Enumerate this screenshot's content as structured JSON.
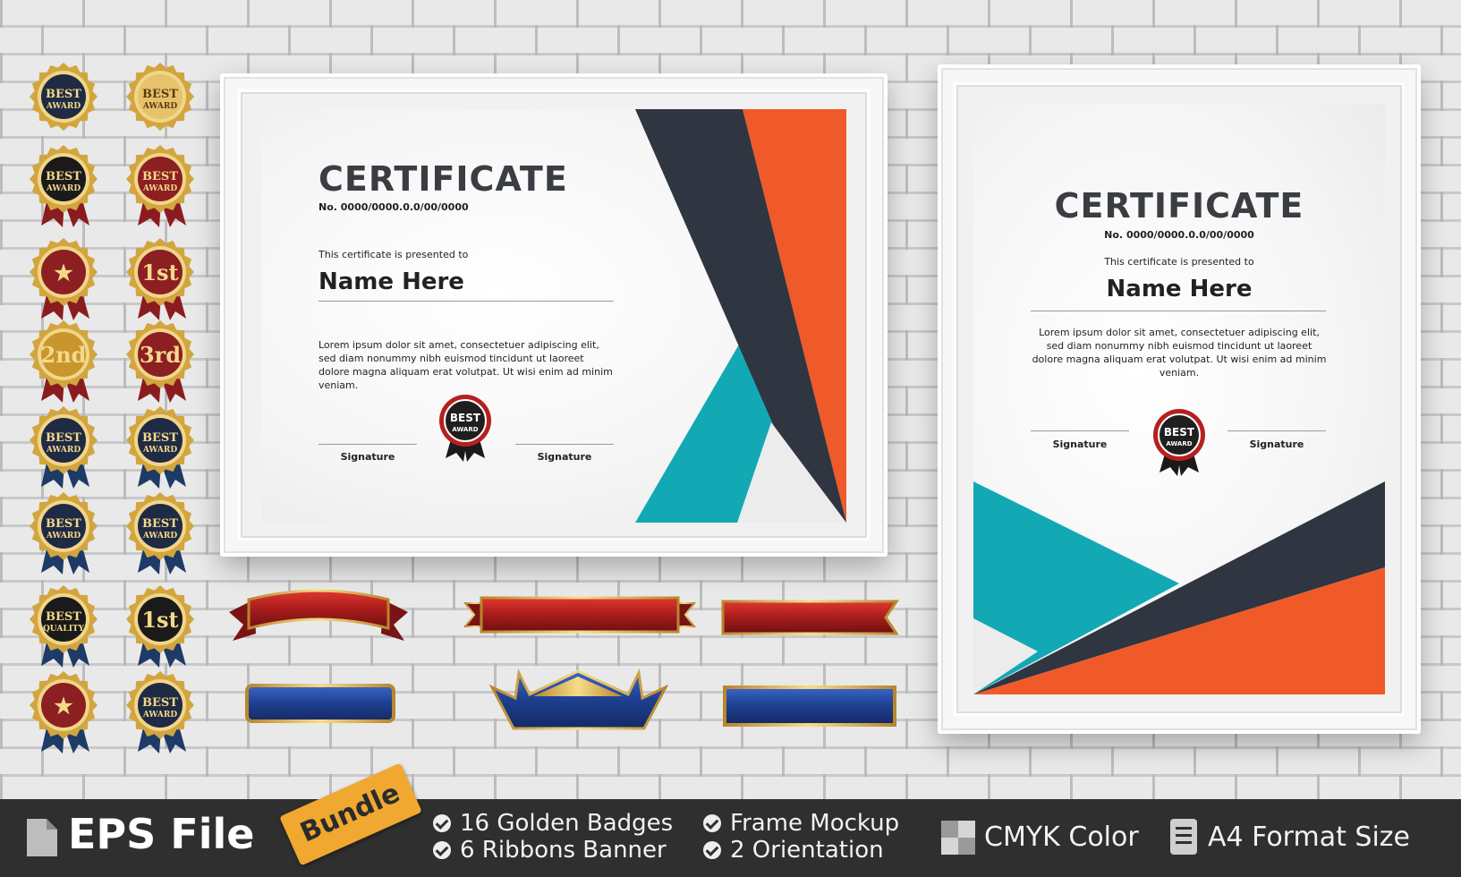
{
  "certificate_landscape": {
    "title": "CERTIFICATE",
    "number": "No. 0000/0000.0.0/00/0000",
    "presented": "This certificate is presented to",
    "name": "Name Here",
    "lorem": "Lorem ipsum dolor sit amet, consectetuer adipiscing elit, sed diam nonummy nibh euismod tincidunt ut laoreet dolore magna aliquam erat volutpat. Ut wisi enim ad minim veniam.",
    "signature_left": "Signature",
    "signature_right": "Signature",
    "seal_line1": "BEST",
    "seal_line2": "AWARD"
  },
  "certificate_portrait": {
    "title": "CERTIFICATE",
    "number": "No. 0000/0000.0.0/00/0000",
    "presented": "This certificate is presented to",
    "name": "Name Here",
    "lorem": "Lorem ipsum dolor sit amet, consectetuer adipiscing elit, sed diam nonummy nibh euismod tincidunt ut laoreet dolore magna aliquam erat volutpat. Ut wisi enim ad minim veniam.",
    "signature_left": "Signature",
    "signature_right": "Signature",
    "seal_line1": "BEST",
    "seal_line2": "AWARD"
  },
  "badges": [
    {
      "line1": "BEST",
      "line2": "AWARD",
      "fill": "#1f2a44"
    },
    {
      "line1": "BEST",
      "line2": "AWARD",
      "fill": "#e6c36a"
    },
    {
      "line1": "BEST",
      "line2": "AWARD",
      "fill": "#1a1a1a"
    },
    {
      "line1": "BEST",
      "line2": "AWARD",
      "fill": "#8c1f22"
    },
    {
      "line1": "★",
      "line2": "",
      "fill": "#8c1f22"
    },
    {
      "line1": "1st",
      "line2": "",
      "fill": "#8c1f22"
    },
    {
      "line1": "2nd",
      "line2": "",
      "fill": "#c9962e"
    },
    {
      "line1": "3rd",
      "line2": "",
      "fill": "#8c1f22"
    },
    {
      "line1": "BEST",
      "line2": "AWARD",
      "fill": "#1f2a44"
    },
    {
      "line1": "BEST",
      "line2": "AWARD",
      "fill": "#1f2a44"
    },
    {
      "line1": "BEST",
      "line2": "AWARD",
      "fill": "#1f2a44"
    },
    {
      "line1": "BEST",
      "line2": "AWARD",
      "fill": "#1f2a44"
    },
    {
      "line1": "BEST",
      "line2": "QUALITY",
      "fill": "#1a1a1a"
    },
    {
      "line1": "1st",
      "line2": "",
      "fill": "#1a1a1a"
    },
    {
      "line1": "★",
      "line2": "",
      "fill": "#8c1f22"
    },
    {
      "line1": "BEST",
      "line2": "AWARD",
      "fill": "#1f2a44"
    }
  ],
  "bar": {
    "file_label": "EPS File",
    "bundle": "Bundle",
    "feature1": "16 Golden Badges",
    "feature2": "6  Ribbons Banner",
    "feature3": "Frame Mockup",
    "feature4": "2 Orientation",
    "color_label": "CMYK Color",
    "format_label": "A4 Format Size"
  },
  "colors": {
    "accent_orange": "#f05a28",
    "accent_teal": "#12a9b5",
    "dark_slate": "#2f3541",
    "ribbon_red": "#a81c1c",
    "ribbon_blue": "#1e3f8f",
    "gold": "#d8b04c",
    "bar_bg": "#2f2f2f"
  }
}
